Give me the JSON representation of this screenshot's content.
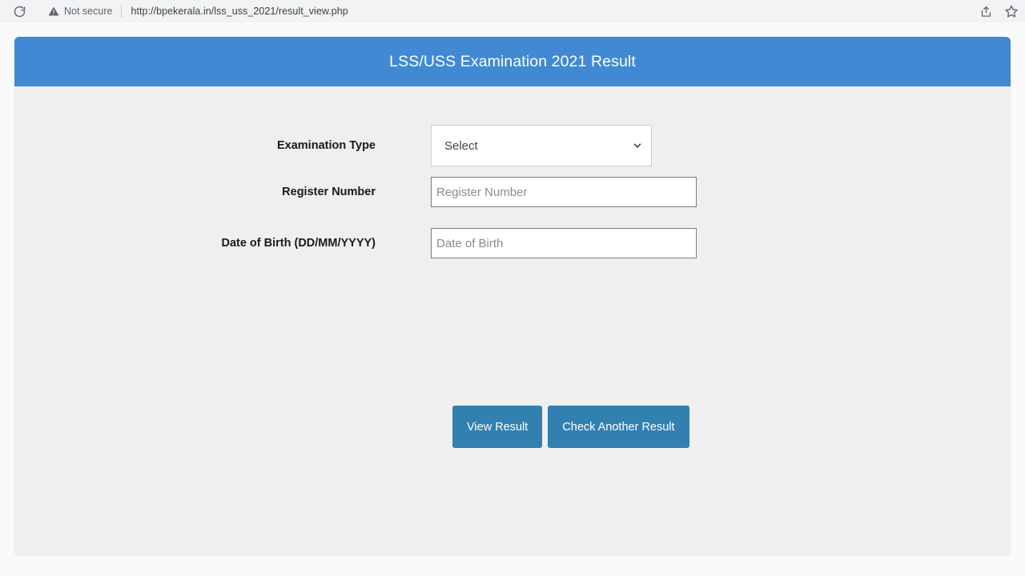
{
  "browser": {
    "reload_icon": "reload-icon",
    "security_icon": "warning-triangle-icon",
    "security_label": "Not secure",
    "url": "http://bpekerala.in/lss_uss_2021/result_view.php",
    "share_icon": "share-icon",
    "bookmark_icon": "star-icon"
  },
  "page": {
    "header": {
      "title": "LSS/USS Examination 2021 Result",
      "background_color": "#4189d3",
      "text_color": "#ffffff"
    },
    "body_background_color": "#efefef",
    "form": {
      "fields": [
        {
          "label": "Examination Type",
          "control": "select",
          "value": "Select",
          "chevron_icon": "chevron-down-icon"
        },
        {
          "label": "Register Number",
          "control": "text",
          "value": "",
          "placeholder": "Register Number"
        },
        {
          "label": "Date of Birth (DD/MM/YYYY)",
          "control": "text",
          "value": "",
          "placeholder": "Date of Birth"
        }
      ]
    },
    "buttons": [
      {
        "label": "View Result",
        "color": "#3280b0"
      },
      {
        "label": "Check Another Result",
        "color": "#3280b0"
      }
    ]
  }
}
